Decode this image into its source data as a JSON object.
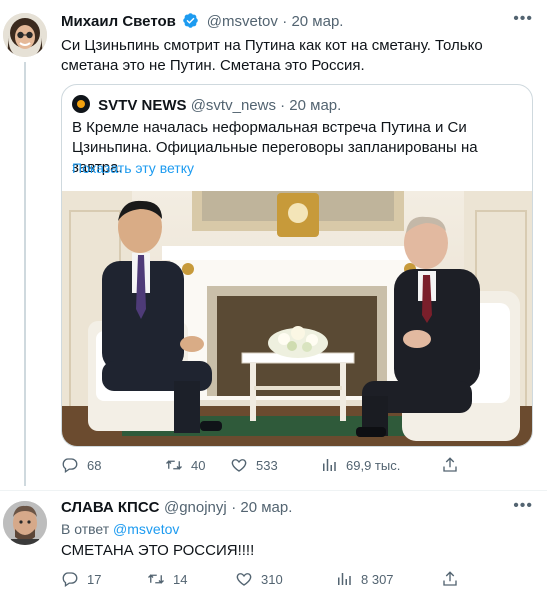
{
  "tweet1": {
    "author_name": "Михаил Светов",
    "handle": "@msvetov",
    "date": "· 20 мар.",
    "text": "Си Цзиньпинь смотрит на Путина как кот на сметану. Только сметана это не Путин. Сметана это Россия.",
    "quote": {
      "author_name": "SVTV NEWS",
      "handle": "@svtv_news",
      "date": "· 20 мар.",
      "text": "В Кремле началась неформальная встреча Путина и Си Цзиньпина. Официальные переговоры запланированы на завтра.",
      "show_thread": "Показать эту ветку"
    },
    "stats": {
      "replies": "68",
      "retweets": "40",
      "likes": "533",
      "views": "69,9 тыс."
    }
  },
  "tweet2": {
    "author_name": "СЛАВА КПСС",
    "handle": "@gnojnyj",
    "date": "· 20 мар.",
    "reply_prefix": "В ответ",
    "reply_to": "@msvetov",
    "text": "СМЕТАНА ЭТО РОССИЯ!!!!",
    "stats": {
      "replies": "17",
      "retweets": "14",
      "likes": "310",
      "views": "8 307"
    }
  },
  "icons": {
    "more": "more-icon",
    "verified": "verified-icon",
    "reply": "reply-icon",
    "retweet": "retweet-icon",
    "like": "heart-icon",
    "views": "views-icon",
    "share": "share-icon"
  },
  "colors": {
    "link": "#1d9bf0",
    "secondary": "#536471",
    "verified": "#1d9bf0"
  }
}
